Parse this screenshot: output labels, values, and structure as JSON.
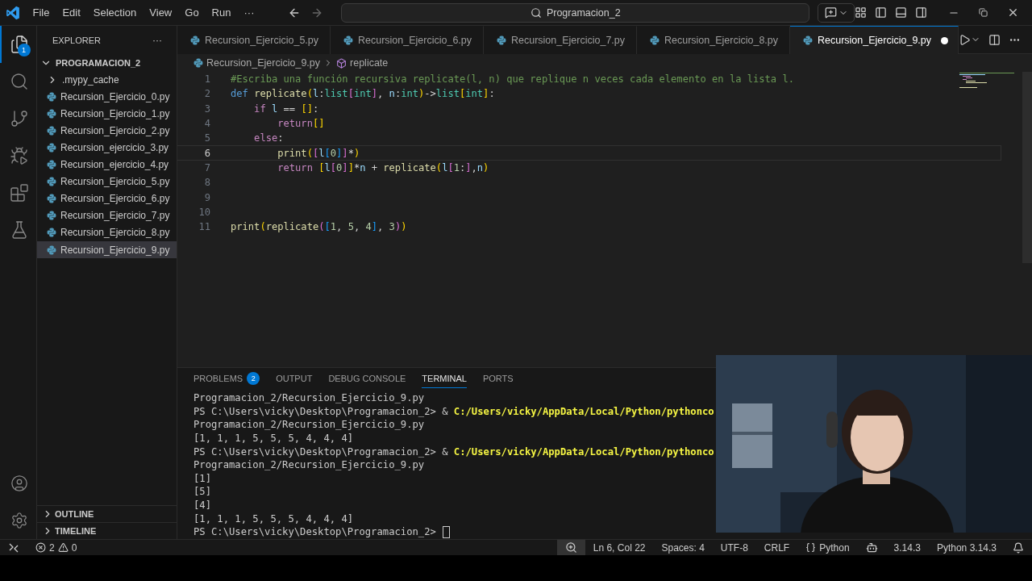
{
  "menu": [
    "File",
    "Edit",
    "Selection",
    "View",
    "Go",
    "Run",
    "···"
  ],
  "search": {
    "value": "Programacion_2"
  },
  "activity": [
    {
      "kind": "explorer",
      "selected": true,
      "badge": "1"
    },
    {
      "kind": "search",
      "selected": false
    },
    {
      "kind": "source",
      "selected": false
    },
    {
      "kind": "debug",
      "selected": false
    },
    {
      "kind": "extensions",
      "selected": false
    },
    {
      "kind": "testing",
      "selected": false
    }
  ],
  "activity_bottom": [
    {
      "kind": "account"
    },
    {
      "kind": "settings"
    }
  ],
  "sidebar": {
    "title": "EXPLORER",
    "more": "···",
    "workspace": {
      "label": "PROGRAMACION_2",
      "expanded": true,
      "children": [
        {
          "kind": "folder",
          "label": ".mypy_cache",
          "expanded": false,
          "selected": false
        },
        {
          "kind": "file",
          "label": "Recursion_Ejercicio_0.py",
          "selected": false
        },
        {
          "kind": "file",
          "label": "Recursion_Ejercicio_1.py",
          "selected": false
        },
        {
          "kind": "file",
          "label": "Recursion_Ejercicio_2.py",
          "selected": false
        },
        {
          "kind": "file",
          "label": "Recursion_ejercicio_3.py",
          "selected": false
        },
        {
          "kind": "file",
          "label": "Recursion_ejercicio_4.py",
          "selected": false
        },
        {
          "kind": "file",
          "label": "Recursion_Ejercicio_5.py",
          "selected": false
        },
        {
          "kind": "file",
          "label": "Recursion_Ejercicio_6.py",
          "selected": false
        },
        {
          "kind": "file",
          "label": "Recursion_Ejercicio_7.py",
          "selected": false
        },
        {
          "kind": "file",
          "label": "Recursion_Ejercicio_8.py",
          "selected": false
        },
        {
          "kind": "file",
          "label": "Recursion_Ejercicio_9.py",
          "selected": true
        }
      ]
    },
    "sections": [
      {
        "label": "OUTLINE",
        "expanded": false
      },
      {
        "label": "TIMELINE",
        "expanded": false
      }
    ]
  },
  "tabs": [
    {
      "label": "Recursion_Ejercicio_5.py",
      "selected": false,
      "dirty": false
    },
    {
      "label": "Recursion_Ejercicio_6.py",
      "selected": false,
      "dirty": false
    },
    {
      "label": "Recursion_Ejercicio_7.py",
      "selected": false,
      "dirty": false
    },
    {
      "label": "Recursion_Ejercicio_8.py",
      "selected": false,
      "dirty": false
    },
    {
      "label": "Recursion_Ejercicio_9.py",
      "selected": true,
      "dirty": true
    }
  ],
  "breadcrumb": {
    "file": "Recursion_Ejercicio_9.py",
    "symbol": "replicate"
  },
  "code": [
    {
      "number": "1",
      "current": false,
      "tokens": [
        {
          "kind": "comment",
          "text": "#Escriba una función recursiva replicate(l, n) que replique n veces cada elemento en la lista l."
        }
      ]
    },
    {
      "number": "2",
      "current": false,
      "tokens": [
        {
          "kind": "keyword",
          "text": "def "
        },
        {
          "kind": "function",
          "text": "replicate"
        },
        {
          "kind": "b1",
          "text": "("
        },
        {
          "kind": "var",
          "text": "l"
        },
        {
          "kind": "plain",
          "text": ":"
        },
        {
          "kind": "type",
          "text": "list"
        },
        {
          "kind": "b2",
          "text": "["
        },
        {
          "kind": "type",
          "text": "int"
        },
        {
          "kind": "b2",
          "text": "]"
        },
        {
          "kind": "plain",
          "text": ","
        },
        {
          "kind": "var",
          "text": " n"
        },
        {
          "kind": "plain",
          "text": ":"
        },
        {
          "kind": "type",
          "text": "int"
        },
        {
          "kind": "b1",
          "text": ")"
        },
        {
          "kind": "plain",
          "text": "->"
        },
        {
          "kind": "type",
          "text": "list"
        },
        {
          "kind": "b1",
          "text": "["
        },
        {
          "kind": "type",
          "text": "int"
        },
        {
          "kind": "b1",
          "text": "]"
        },
        {
          "kind": "plain",
          "text": ":"
        }
      ]
    },
    {
      "number": "3",
      "current": false,
      "tokens": [
        {
          "kind": "control",
          "text": "    if"
        },
        {
          "kind": "var",
          "text": " l"
        },
        {
          "kind": "plain",
          "text": " == "
        },
        {
          "kind": "b1",
          "text": "[]"
        },
        {
          "kind": "plain",
          "text": ":"
        }
      ]
    },
    {
      "number": "4",
      "current": false,
      "tokens": [
        {
          "kind": "control",
          "text": "        return"
        },
        {
          "kind": "b1",
          "text": "[]"
        }
      ]
    },
    {
      "number": "5",
      "current": false,
      "tokens": [
        {
          "kind": "control",
          "text": "    else"
        },
        {
          "kind": "plain",
          "text": ":"
        }
      ]
    },
    {
      "number": "6",
      "current": true,
      "tokens": [
        {
          "kind": "function",
          "text": "        print"
        },
        {
          "kind": "b1",
          "text": "("
        },
        {
          "kind": "b2",
          "text": "["
        },
        {
          "kind": "var",
          "text": "l"
        },
        {
          "kind": "b3",
          "text": "["
        },
        {
          "kind": "number",
          "text": "0"
        },
        {
          "kind": "b3",
          "text": "]"
        },
        {
          "kind": "b2",
          "text": "]"
        },
        {
          "kind": "plain",
          "text": "*"
        },
        {
          "kind": "b1",
          "text": ")"
        }
      ]
    },
    {
      "number": "7",
      "current": false,
      "tokens": [
        {
          "kind": "control",
          "text": "        return"
        },
        {
          "kind": "b1",
          "text": " ["
        },
        {
          "kind": "var",
          "text": "l"
        },
        {
          "kind": "b2",
          "text": "["
        },
        {
          "kind": "number",
          "text": "0"
        },
        {
          "kind": "b2",
          "text": "]"
        },
        {
          "kind": "b1",
          "text": "]"
        },
        {
          "kind": "plain",
          "text": "*"
        },
        {
          "kind": "var",
          "text": "n"
        },
        {
          "kind": "plain",
          "text": " + "
        },
        {
          "kind": "function",
          "text": "replicate"
        },
        {
          "kind": "b1",
          "text": "("
        },
        {
          "kind": "var",
          "text": "l"
        },
        {
          "kind": "b2",
          "text": "["
        },
        {
          "kind": "number",
          "text": "1"
        },
        {
          "kind": "plain",
          "text": ":"
        },
        {
          "kind": "b2",
          "text": "]"
        },
        {
          "kind": "plain",
          "text": ","
        },
        {
          "kind": "var",
          "text": "n"
        },
        {
          "kind": "b1",
          "text": ")"
        }
      ]
    },
    {
      "number": "8",
      "current": false
    },
    {
      "number": "9",
      "current": false
    },
    {
      "number": "10",
      "current": false
    },
    {
      "number": "11",
      "current": false,
      "tokens": [
        {
          "kind": "function",
          "text": "print"
        },
        {
          "kind": "b1",
          "text": "("
        },
        {
          "kind": "function",
          "text": "replicate"
        },
        {
          "kind": "b2",
          "text": "("
        },
        {
          "kind": "b3",
          "text": "["
        },
        {
          "kind": "number",
          "text": "1"
        },
        {
          "kind": "plain",
          "text": ", "
        },
        {
          "kind": "number",
          "text": "5"
        },
        {
          "kind": "plain",
          "text": ", "
        },
        {
          "kind": "number",
          "text": "4"
        },
        {
          "kind": "b3",
          "text": "]"
        },
        {
          "kind": "plain",
          "text": ", "
        },
        {
          "kind": "number",
          "text": "3"
        },
        {
          "kind": "b2",
          "text": ")"
        },
        {
          "kind": "b1",
          "text": ")"
        }
      ]
    }
  ],
  "panel_tabs": [
    {
      "label": "PROBLEMS",
      "selected": false,
      "badge": "2"
    },
    {
      "label": "OUTPUT",
      "selected": false
    },
    {
      "label": "DEBUG CONSOLE",
      "selected": false
    },
    {
      "label": "TERMINAL",
      "selected": true
    },
    {
      "label": "PORTS",
      "selected": false
    }
  ],
  "terminal": [
    [
      {
        "kind": "plain",
        "text": "Programacion_2/Recursion_Ejercicio_9.py"
      }
    ],
    [
      {
        "kind": "plain",
        "text": "PS C:\\Users\\vicky\\Desktop\\Programacion_2> &"
      },
      {
        "kind": "path",
        "text": " C:/Users/vicky/AppData/Local/Python/pythonco"
      }
    ],
    [
      {
        "kind": "plain",
        "text": "Programacion_2/Recursion_Ejercicio_9.py"
      }
    ],
    [
      {
        "kind": "plain",
        "text": "[1, 1, 1, 5, 5, 5, 4, 4, 4]"
      }
    ],
    [
      {
        "kind": "plain",
        "text": "PS C:\\Users\\vicky\\Desktop\\Programacion_2> &"
      },
      {
        "kind": "path",
        "text": " C:/Users/vicky/AppData/Local/Python/pythonco"
      }
    ],
    [
      {
        "kind": "plain",
        "text": "Programacion_2/Recursion_Ejercicio_9.py"
      }
    ],
    [
      {
        "kind": "plain",
        "text": "[1]"
      }
    ],
    [
      {
        "kind": "plain",
        "text": "[5]"
      }
    ],
    [
      {
        "kind": "plain",
        "text": "[4]"
      }
    ],
    [
      {
        "kind": "plain",
        "text": "[1, 1, 1, 5, 5, 5, 4, 4, 4]"
      }
    ],
    [
      {
        "kind": "plain",
        "text": "PS C:\\Users\\vicky\\Desktop\\Programacion_2>"
      }
    ]
  ],
  "status": {
    "errors": "2",
    "warnings": "0",
    "right": [
      {
        "kind": "zoom"
      },
      {
        "kind": "text",
        "label": "Ln 6, Col 22"
      },
      {
        "kind": "text",
        "label": "Spaces: 4"
      },
      {
        "kind": "text",
        "label": "UTF-8"
      },
      {
        "kind": "text",
        "label": "CRLF"
      },
      {
        "kind": "language",
        "label": "Python"
      },
      {
        "kind": "copilot"
      },
      {
        "kind": "text",
        "label": "3.14.3"
      },
      {
        "kind": "text",
        "label": "Python 3.14.3"
      },
      {
        "kind": "bell"
      }
    ]
  },
  "webcam": {
    "kind": "picture"
  }
}
